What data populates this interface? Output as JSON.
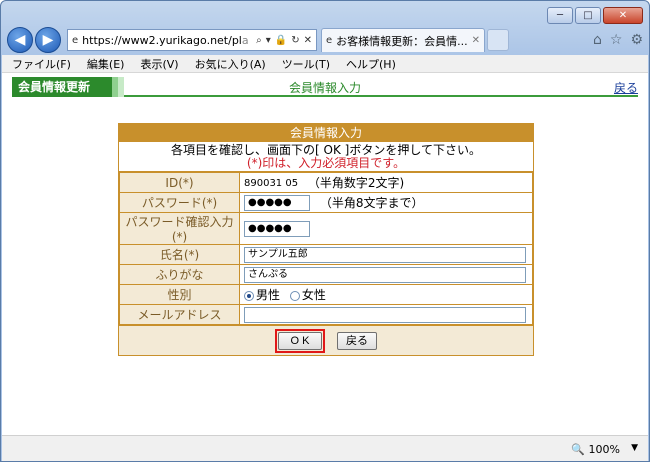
{
  "window": {
    "minimize": "─",
    "maximize": "□",
    "close": "✕"
  },
  "nav": {
    "back": "◀",
    "forward": "▶",
    "url_main": "https://www2.yurikago.net/pl",
    "url_dim": "a",
    "tab_title": "お客様情報更新：会員情...",
    "tab_close": "✕"
  },
  "menu": [
    "ファイル(F)",
    "編集(E)",
    "表示(V)",
    "お気に入り(A)",
    "ツール(T)",
    "ヘルプ(H)"
  ],
  "header": {
    "tab_label": "会員情報更新",
    "center_title": "会員情報入力",
    "back_link": "戻る"
  },
  "form": {
    "title": "会員情報入力",
    "instruction": "各項目を確認し、画面下の[ OK ]ボタンを押して下さい。",
    "required_note": "(*)印は、入力必須項目です。",
    "fields": {
      "id_label": "ID(*)",
      "id_value": "890031 05",
      "id_note": "（半角数字2文字)",
      "password_label": "パスワード(*)",
      "password_value": "●●●●●",
      "password_note": "（半角8文字まで）",
      "password_confirm_label": "パスワード確認入力(*)",
      "password_confirm_value": "●●●●●",
      "name_label": "氏名(*)",
      "name_value": "サンプル五郎",
      "furigana_label": "ふりがな",
      "furigana_value": "さんぷる",
      "gender_label": "性別",
      "gender_male": "男性",
      "gender_female": "女性",
      "gender_selected": "male",
      "email_label": "メールアドレス",
      "email_value": ""
    },
    "ok_button": "O K",
    "back_button": "戻る"
  },
  "status": {
    "zoom": "100%",
    "zoom_arrow": "▼"
  }
}
